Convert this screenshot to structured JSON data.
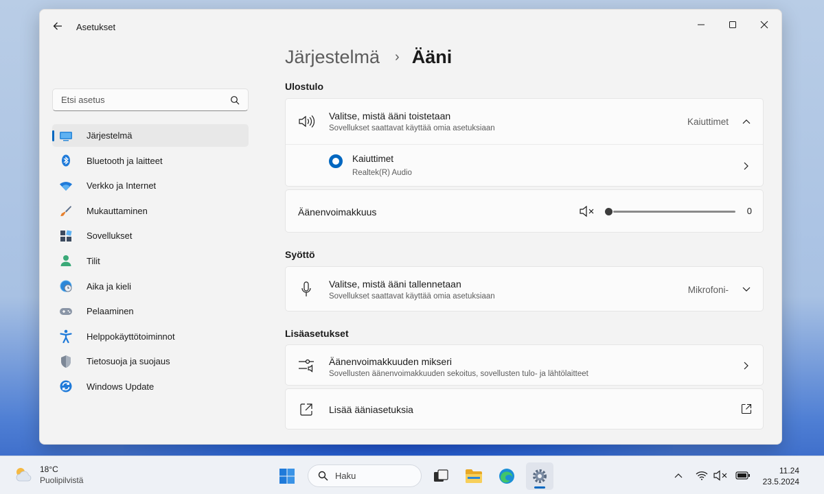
{
  "window": {
    "app_title": "Asetukset"
  },
  "search": {
    "placeholder": "Etsi asetus"
  },
  "sidebar": {
    "items": [
      {
        "label": "Järjestelmä",
        "icon": "system-icon"
      },
      {
        "label": "Bluetooth ja laitteet",
        "icon": "bluetooth-icon"
      },
      {
        "label": "Verkko ja Internet",
        "icon": "wifi-icon"
      },
      {
        "label": "Mukauttaminen",
        "icon": "brush-icon"
      },
      {
        "label": "Sovellukset",
        "icon": "apps-icon"
      },
      {
        "label": "Tilit",
        "icon": "account-icon"
      },
      {
        "label": "Aika ja kieli",
        "icon": "globe-clock-icon"
      },
      {
        "label": "Pelaaminen",
        "icon": "gamepad-icon"
      },
      {
        "label": "Helppokäyttötoiminnot",
        "icon": "accessibility-icon"
      },
      {
        "label": "Tietosuoja ja suojaus",
        "icon": "shield-icon"
      },
      {
        "label": "Windows Update",
        "icon": "update-icon"
      }
    ],
    "active_index": 0
  },
  "breadcrumb": {
    "parent": "Järjestelmä",
    "separator": "›",
    "current": "Ääni"
  },
  "output": {
    "section_title": "Ulostulo",
    "choose_title": "Valitse, mistä ääni toistetaan",
    "choose_sub": "Sovellukset saattavat käyttää omia asetuksiaan",
    "choose_value": "Kaiuttimet",
    "device_name": "Kaiuttimet",
    "device_desc": "Realtek(R) Audio",
    "volume_label": "Äänenvoimakkuus",
    "volume_value": "0",
    "volume_level": 0,
    "muted": true
  },
  "input": {
    "section_title": "Syöttö",
    "choose_title": "Valitse, mistä ääni tallennetaan",
    "choose_sub": "Sovellukset saattavat käyttää omia asetuksiaan",
    "choose_value": "Mikrofoni-"
  },
  "advanced": {
    "section_title": "Lisäasetukset",
    "mixer_title": "Äänenvoimakkuuden mikseri",
    "mixer_sub": "Sovellusten äänenvoimakkuuden sekoitus, sovellusten tulo- ja lähtölaitteet",
    "more_title": "Lisää ääniasetuksia"
  },
  "taskbar": {
    "weather_temp": "18°C",
    "weather_desc": "Puolipilvistä",
    "search_label": "Haku",
    "time": "11.24",
    "date": "23.5.2024"
  },
  "colors": {
    "accent": "#0067c0"
  }
}
